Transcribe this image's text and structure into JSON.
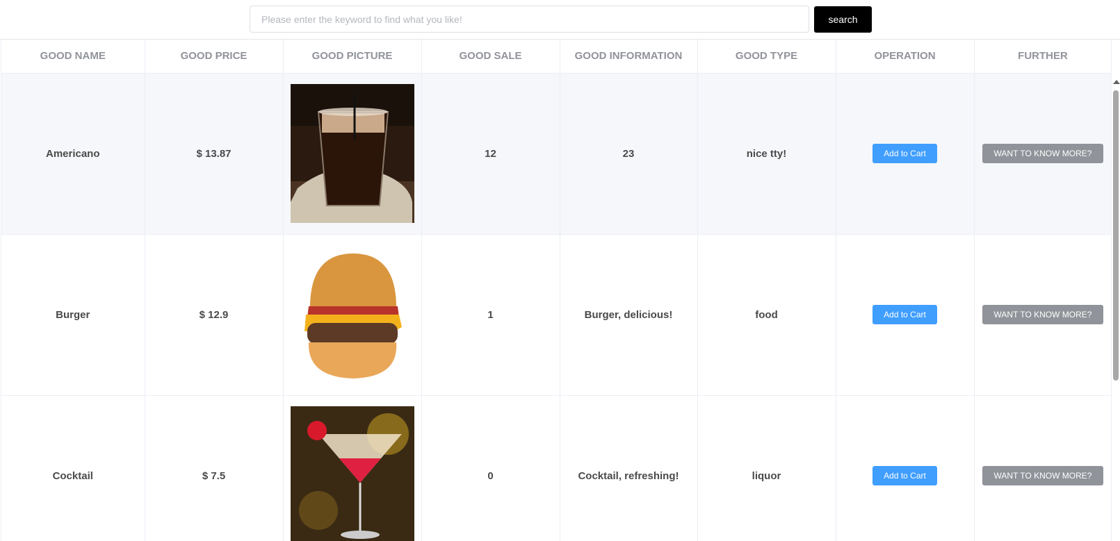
{
  "search": {
    "placeholder": "Please enter the keyword to find what you like!",
    "button_label": "search"
  },
  "table": {
    "headers": [
      "GOOD NAME",
      "GOOD PRICE",
      "GOOD PICTURE",
      "GOOD SALE",
      "GOOD INFORMATION",
      "GOOD TYPE",
      "OPERATION",
      "FURTHER"
    ],
    "rows": [
      {
        "name": "Americano",
        "price": "$ 13.87",
        "picture": "iced-americano-photo",
        "sale": "12",
        "information": "23",
        "type": "nice tty!",
        "operation": "Add to Cart",
        "further": "WANT TO KNOW MORE?"
      },
      {
        "name": "Burger",
        "price": "$ 12.9",
        "picture": "cheeseburger-photo",
        "sale": "1",
        "information": "Burger, delicious!",
        "type": "food",
        "operation": "Add to Cart",
        "further": "WANT TO KNOW MORE?"
      },
      {
        "name": "Cocktail",
        "price": "$ 7.5",
        "picture": "cocktail-photo",
        "sale": "0",
        "information": "Cocktail, refreshing!",
        "type": "liquor",
        "operation": "Add to Cart",
        "further": "WANT TO KNOW MORE?"
      }
    ]
  },
  "colors": {
    "primary_button": "#409eff",
    "info_button": "#909399",
    "search_button": "#000000",
    "row_hover": "#f5f7fa",
    "header_text": "#909399"
  }
}
